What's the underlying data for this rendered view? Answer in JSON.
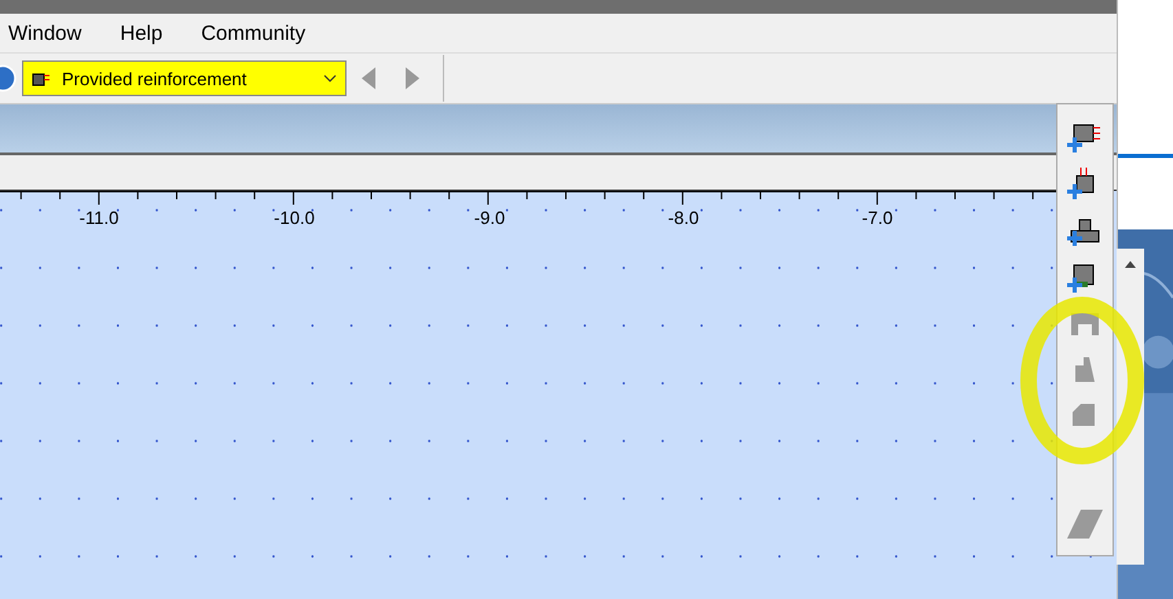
{
  "menu": [
    "Window",
    "Help",
    "Community"
  ],
  "toolbar": {
    "dropdown": {
      "value": "Provided reinforcement",
      "highlighted": true
    }
  },
  "ruler": {
    "labels": [
      "-11.0",
      "-10.0",
      "-9.0",
      "-8.0",
      "-7.0"
    ]
  },
  "side_tools": [
    {
      "kind": "beam",
      "disabled": false
    },
    {
      "kind": "column",
      "disabled": false
    },
    {
      "kind": "footing",
      "disabled": false
    },
    {
      "kind": "beam-support",
      "disabled": false
    },
    {
      "kind": "frame",
      "disabled": true
    },
    {
      "kind": "wall",
      "disabled": true
    },
    {
      "kind": "slab",
      "disabled": true
    },
    {
      "kind": "gap"
    },
    {
      "kind": "plate",
      "disabled": true
    }
  ],
  "annotation": {
    "circle": true
  }
}
